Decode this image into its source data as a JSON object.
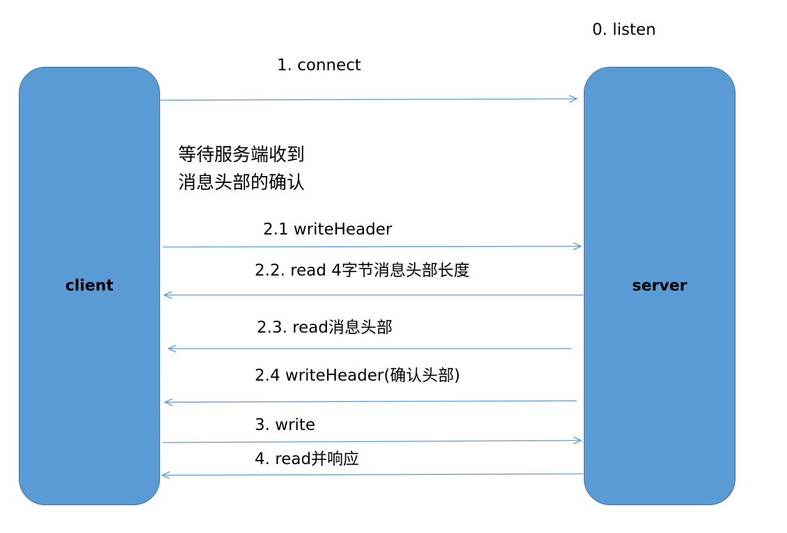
{
  "nodes": {
    "client": "client",
    "server": "server"
  },
  "messages": {
    "listen": "0. listen",
    "connect": "1. connect",
    "write_header": "2.1 writeHeader",
    "read_header_length": "2.2. read 4字节消息头部长度",
    "read_header": "2.3. read消息头部",
    "write_header_ack": "2.4 writeHeader(确认头部)",
    "write": "3.  write",
    "read_respond": "4. read并响应"
  },
  "note": {
    "line1": "等待服务端收到",
    "line2": "消息头部的确认"
  },
  "colors": {
    "node_fill": "#5b9bd5",
    "node_border": "#41719c",
    "arrow": "#5b9bd5"
  }
}
